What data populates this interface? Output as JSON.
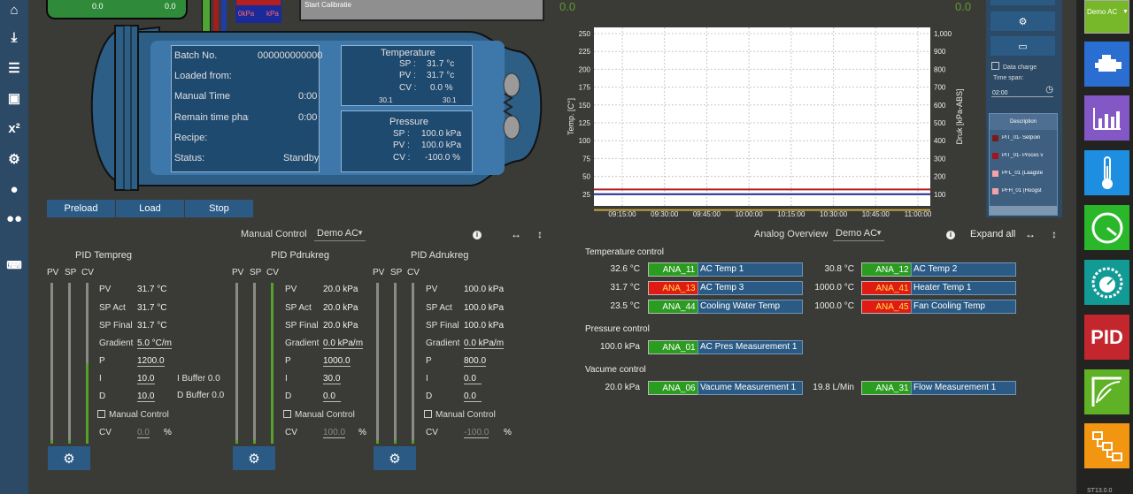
{
  "nav": {
    "icons": [
      "home-icon",
      "download-icon",
      "list-icon",
      "frame-icon",
      "x-squared-icon",
      "gears-icon",
      "user-icon",
      "users-icon",
      "keyboard-icon"
    ]
  },
  "top": {
    "gauge_left": "0.0",
    "gauge_right": "0.0",
    "kpa_left": "0kPa",
    "kpa_right": "kPa",
    "start_calibration": "Start Calibratie",
    "chart_left_value": "0.0",
    "chart_right_value": "0.0"
  },
  "tank": {
    "batch_label": "Batch No.",
    "batch_value": "000000000000",
    "loaded_label": "Loaded from:",
    "manual_time_label": "Manual Time",
    "manual_time_value": "0:00",
    "remain_label": "Remain time phas",
    "remain_value": "0:00",
    "recipe_label": "Recipe:",
    "status_label": "Status:",
    "status_value": "Standby",
    "temp_title": "Temperature",
    "temp_sp_label": "SP :",
    "temp_sp": "31.7 °c",
    "temp_pv_label": "PV :",
    "temp_pv": "31.7 °c",
    "temp_cv_label": "CV :",
    "temp_cv": "0.0  %",
    "temp_small_left": "30.1",
    "temp_small_right": "30.1",
    "pres_title": "Pressure",
    "pres_sp_label": "SP :",
    "pres_sp": "100.0 kPa",
    "pres_pv_label": "PV :",
    "pres_pv": "100.0 kPa",
    "pres_cv_label": "CV :",
    "pres_cv": "-100.0  %"
  },
  "buttons": {
    "preload": "Preload",
    "load": "Load",
    "stop": "Stop"
  },
  "manual": {
    "label": "Manual Control",
    "select": "Demo AC"
  },
  "analog": {
    "label": "Analog Overview",
    "select": "Demo AC",
    "expand": "Expand all"
  },
  "pid_headers": {
    "pv": "PV",
    "sp": "SP",
    "cv": "CV"
  },
  "pids": [
    {
      "title": "PID Tempreg",
      "pv_l": "PV",
      "pv": "31.7 °C",
      "spact_l": "SP Act",
      "spact": "31.7 °C",
      "spfinal_l": "SP Final",
      "spfinal": "31.7 °C",
      "grad_l": "Gradient",
      "grad": "5.0 °C/m",
      "p_l": "P",
      "p": "1200.0",
      "i_l": "I",
      "i": "10.0",
      "d_l": "D",
      "d": "10.0",
      "ibuf": "I Buffer 0.0",
      "dbuf": "D Buffer 0.0",
      "manual": "Manual Control",
      "cv_l": "CV",
      "cv": "0.0",
      "pct": "%",
      "pv_level": 0.0,
      "sp_level": 0.0,
      "cv_level": 0.5
    },
    {
      "title": "PID Pdrukreg",
      "pv_l": "PV",
      "pv": "20.0 kPa",
      "spact_l": "SP Act",
      "spact": "20.0 kPa",
      "spfinal_l": "SP Final",
      "spfinal": "20.0 kPa",
      "grad_l": "Gradient",
      "grad": "0.0 kPa/m",
      "p_l": "P",
      "p": "1000.0",
      "i_l": "I",
      "i": "30.0",
      "d_l": "D",
      "d": "0.0",
      "manual": "Manual Control",
      "cv_l": "CV",
      "cv": "100.0",
      "pct": "%",
      "pv_level": 0.0,
      "sp_level": 0.0,
      "cv_level": 1.0
    },
    {
      "title": "PID Adrukreg",
      "pv_l": "PV",
      "pv": "100.0 kPa",
      "spact_l": "SP Act",
      "spact": "100.0 kPa",
      "spfinal_l": "SP Final",
      "spfinal": "100.0 kPa",
      "grad_l": "Gradient",
      "grad": "0.0 kPa/m",
      "p_l": "P",
      "p": "800.0",
      "i_l": "I",
      "i": "0.0",
      "d_l": "D",
      "d": "0.0",
      "manual": "Manual Control",
      "cv_l": "CV",
      "cv": "-100.0",
      "pct": "%",
      "pv_level": 0.0,
      "sp_level": 0.0,
      "cv_level": 0.0
    }
  ],
  "analog_sections": {
    "temp": "Temperature control",
    "pres": "Pressure control",
    "vac": "Vacume control",
    "rows": [
      {
        "v": "32.6 °C",
        "tag": "ANA_11",
        "c": "g",
        "d": "AC Temp 1"
      },
      {
        "v": "30.8 °C",
        "tag": "ANA_12",
        "c": "g",
        "d": "AC Temp 2"
      },
      {
        "v": "31.7 °C",
        "tag": "ANA_13",
        "c": "r",
        "d": "AC Temp 3"
      },
      {
        "v": "1000.0 °C",
        "tag": "ANA_41",
        "c": "r",
        "d": "Heater Temp 1"
      },
      {
        "v": "23.5 °C",
        "tag": "ANA_44",
        "c": "g",
        "d": "Cooling Water Temp"
      },
      {
        "v": "1000.0 °C",
        "tag": "ANA_45",
        "c": "r",
        "d": "Fan Cooling Temp"
      },
      {
        "v": "100.0 kPa",
        "tag": "ANA_01",
        "c": "g",
        "d": "AC Pres Measurement 1"
      },
      {
        "v": "20.0 kPa",
        "tag": "ANA_06",
        "c": "g",
        "d": "Vacume Measurement 1"
      },
      {
        "v": "19.8 L/Min",
        "tag": "ANA_31",
        "c": "g",
        "d": "Flow Measurement 1"
      }
    ]
  },
  "chart_data": {
    "type": "line",
    "ylabel": "Temp. [C°]",
    "y2label": "Druk [kPa-ABS]",
    "ylim": [
      0,
      250
    ],
    "y2lim": [
      0,
      1000
    ],
    "yticks": [
      "250",
      "225",
      "200",
      "175",
      "150",
      "125",
      "100",
      "75",
      "50",
      "25"
    ],
    "y2ticks": [
      "1,000",
      "900",
      "800",
      "700",
      "600",
      "500",
      "400",
      "300",
      "200",
      "100"
    ],
    "xticks": [
      "09:15:00",
      "09:30:00",
      "09:45:00",
      "10:00:00",
      "10:15:00",
      "10:30:00",
      "10:45:00",
      "11:00:00"
    ],
    "series": [
      {
        "color": "#b01c1c",
        "values": [
          31.7,
          31.7
        ]
      },
      {
        "color": "#1a2a8c",
        "values": [
          25,
          25
        ]
      },
      {
        "color": "#c9a640",
        "values": [
          3,
          3
        ]
      }
    ]
  },
  "side": {
    "data_charge": "Data charge",
    "time_span": "Time span:",
    "time_value": "02:00",
    "description": "Description",
    "legend": [
      {
        "label": "PIT_01- Setpoin",
        "color": "#7a1a1a"
      },
      {
        "label": "PIT_01- Proces v",
        "color": "#a0151f"
      },
      {
        "label": "PFL_01 (Laagste",
        "color": "#f3a4a8"
      },
      {
        "label": "PFH_01 (Hoogst",
        "color": "#f3a4a8"
      }
    ]
  },
  "rightnav": {
    "select": "Demo AC",
    "tiles": [
      "engine-icon",
      "bar-chart-icon",
      "thermometer-icon",
      "gauge-icon",
      "dial-icon",
      "pid-icon",
      "meter-icon",
      "flowchart-icon"
    ],
    "pid_text": "PID",
    "version": "ST13.0.0"
  }
}
